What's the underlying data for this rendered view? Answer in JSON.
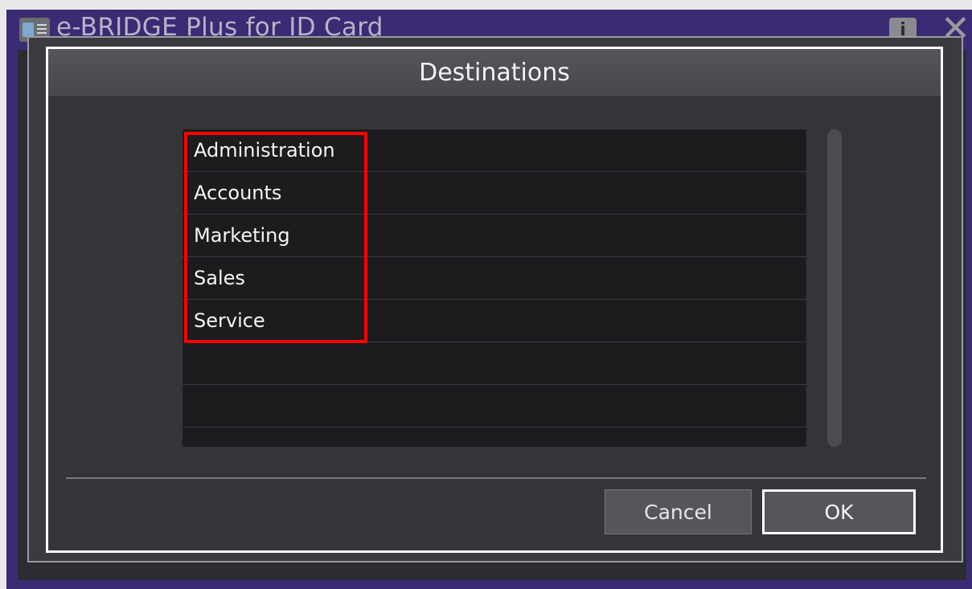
{
  "app": {
    "title": "e-BRIDGE Plus for ID Card",
    "icons": {
      "app": "id-card-icon",
      "info": "info-icon",
      "close": "close-icon"
    },
    "info_glyph": "i",
    "close_glyph": "✕"
  },
  "dialog": {
    "title": "Destinations",
    "items": [
      {
        "label": "Administration"
      },
      {
        "label": "Accounts"
      },
      {
        "label": "Marketing"
      },
      {
        "label": "Sales"
      },
      {
        "label": "Service"
      },
      {
        "label": ""
      },
      {
        "label": ""
      },
      {
        "label": ""
      }
    ],
    "buttons": {
      "cancel": "Cancel",
      "ok": "OK"
    }
  },
  "colors": {
    "app_background": "#3b2a74",
    "dialog_background": "#343539",
    "list_background": "#1c1c1e",
    "highlight": "#ff0000",
    "focus_border": "#ffffff"
  }
}
